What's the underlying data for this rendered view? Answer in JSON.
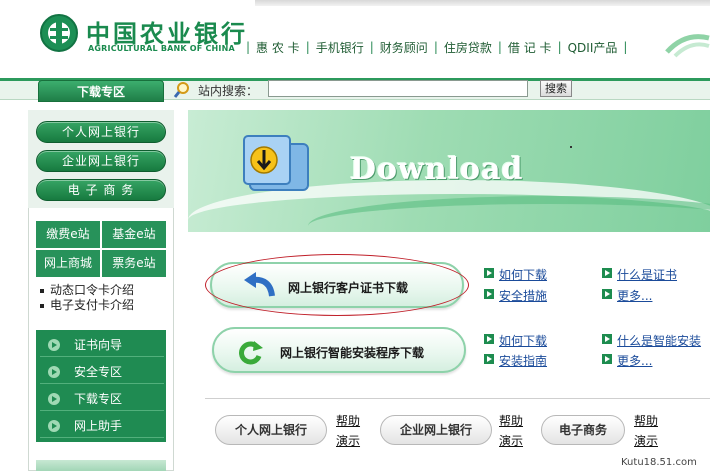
{
  "header": {
    "logo_cn": "中国农业银行",
    "logo_en": "AGRICULTURAL BANK OF CHINA",
    "nav": [
      "惠 农 卡",
      "手机银行",
      "财务顾问",
      "住房贷款",
      "借 记 卡",
      "QDII产品"
    ]
  },
  "search": {
    "tab_label": "下载专区",
    "label": "站内搜索：",
    "input_value": "",
    "button_label": "搜索"
  },
  "sidebar": {
    "main_buttons": [
      "个人网上银行",
      "企业网上银行",
      "电 子 商 务"
    ],
    "stations": [
      "缴费e站",
      "基金e站",
      "网上商城",
      "票务e站"
    ],
    "card_links": [
      "动态口令卡介绍",
      "电子支付卡介绍"
    ],
    "nav_items": [
      "证书向导",
      "安全专区",
      "下载专区",
      "网上助手"
    ]
  },
  "banner": {
    "title": "Download"
  },
  "downloads": [
    {
      "label": "网上银行客户证书下载",
      "links": [
        "如何下载",
        "安全措施",
        "什么是证书",
        "更多..."
      ]
    },
    {
      "label": "网上银行智能安装程序下载",
      "links": [
        "如何下载",
        "安装指南",
        "什么是智能安装",
        "更多..."
      ]
    }
  ],
  "bottom_row": {
    "buttons": [
      "个人网上银行",
      "企业网上银行",
      "电子商务"
    ],
    "help_label": "帮助",
    "demo_label": "演示"
  },
  "watermark": "Kutu18.51.com",
  "colors": {
    "brand_green": "#1c8f55",
    "link_blue": "#1b4b9a",
    "highlight_red": "#c0202a"
  }
}
